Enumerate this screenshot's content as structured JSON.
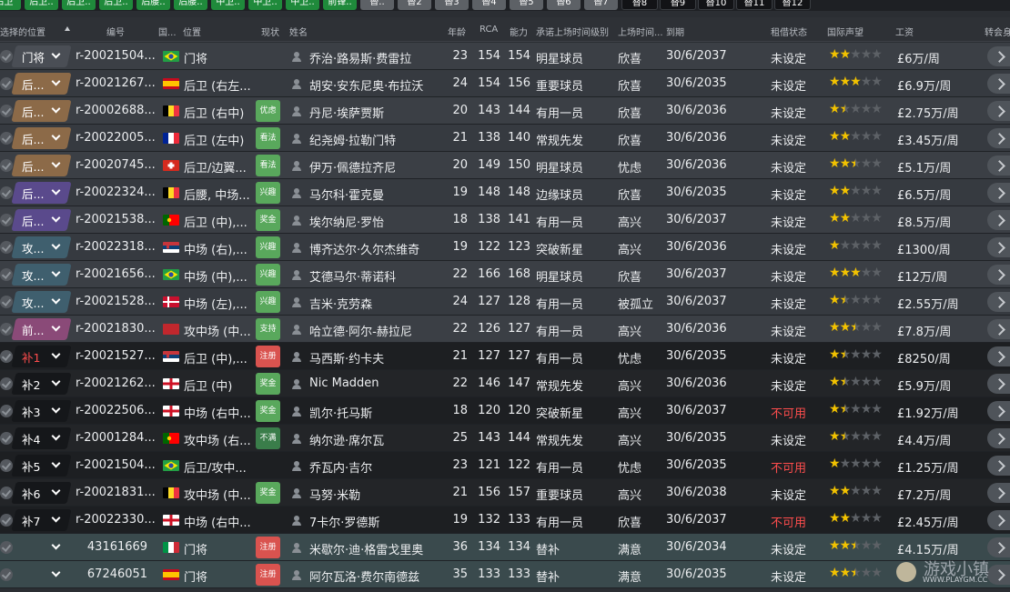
{
  "toolbar": {
    "buttons": [
      {
        "label": "后卫",
        "style": "green"
      },
      {
        "label": "后卫..",
        "style": "green"
      },
      {
        "label": "后卫..",
        "style": "green"
      },
      {
        "label": "后卫..",
        "style": "green"
      },
      {
        "label": "后腰..",
        "style": "green"
      },
      {
        "label": "后腰..",
        "style": "green"
      },
      {
        "label": "中卫..",
        "style": "green"
      },
      {
        "label": "中卫..",
        "style": "green"
      },
      {
        "label": "中卫..",
        "style": "green"
      },
      {
        "label": "前锋..",
        "style": "green"
      },
      {
        "label": "替..",
        "style": "grey"
      },
      {
        "label": "替2",
        "style": "grey"
      },
      {
        "label": "替3",
        "style": "grey"
      },
      {
        "label": "替4",
        "style": "grey"
      },
      {
        "label": "替5",
        "style": "grey"
      },
      {
        "label": "替6",
        "style": "grey"
      },
      {
        "label": "替7",
        "style": "grey"
      },
      {
        "label": "替8",
        "style": "black"
      },
      {
        "label": "替9",
        "style": "black"
      },
      {
        "label": "替10",
        "style": "black"
      },
      {
        "label": "替11",
        "style": "black"
      },
      {
        "label": "替12",
        "style": "black"
      }
    ]
  },
  "columns": {
    "selected_position": "选择的位置",
    "id": "编号",
    "nation": "国...",
    "position": "位置",
    "status": "现状",
    "name": "姓名",
    "age": "年龄",
    "rca": "RCA",
    "ability": "能力",
    "promised_level": "承诺上场时间级别",
    "playing_time": "上场时间...",
    "expires": "到期",
    "loan_status": "租借状态",
    "intl_reputation": "国际声望",
    "wage": "工资",
    "transfer": "转会身"
  },
  "colors": {
    "gk_sel": "#4a4e55",
    "def_brown": "#8c6a48",
    "def_purple": "#5a4a8c",
    "mid_teal": "#3f5f6e",
    "fwd_pink": "#8a4a78",
    "sub_black": "#15171a",
    "star": "#f2c200",
    "star_off": "#5d6166",
    "unavailable": "#ff4d4d"
  },
  "players": [
    {
      "sel": "门将",
      "sel_type": "gk",
      "id": "r-20021504...",
      "flag": "brazil",
      "pos": "门将",
      "badge": "",
      "badge_color": "",
      "name": "乔治·路易斯·费雷拉",
      "age": "23",
      "rca": "154",
      "ab": "154",
      "level": "明星球员",
      "time": "欣喜",
      "exp": "30/6/2037",
      "loan": "未设定",
      "stars": 2,
      "half": false,
      "wage": "£6万/周",
      "row": "main"
    },
    {
      "sel": "后...",
      "sel_type": "def_brown",
      "id": "r-20021267...",
      "flag": "spain",
      "pos": "后卫 (右左...",
      "badge": "",
      "badge_color": "",
      "name": "胡安·安东尼奥·布拉沃",
      "age": "24",
      "rca": "154",
      "ab": "156",
      "level": "重要球员",
      "time": "欣喜",
      "exp": "30/6/2035",
      "loan": "未设定",
      "stars": 3,
      "half": false,
      "wage": "£6.9万/周",
      "row": "main"
    },
    {
      "sel": "后...",
      "sel_type": "def_brown",
      "id": "r-20002688...",
      "flag": "belgium",
      "pos": "后卫 (右中)",
      "badge": "优虑",
      "badge_color": "#59a85c",
      "name": "丹尼·埃萨贾斯",
      "age": "20",
      "rca": "143",
      "ab": "144",
      "level": "有用一员",
      "time": "欣喜",
      "exp": "30/6/2036",
      "loan": "未设定",
      "stars": 1,
      "half": true,
      "wage": "£2.75万/周",
      "row": "main"
    },
    {
      "sel": "后...",
      "sel_type": "def_brown",
      "id": "r-20022005...",
      "flag": "france",
      "pos": "后卫 (左中)",
      "badge": "看法",
      "badge_color": "#59a85c",
      "name": "纪尧姆·拉勒门特",
      "age": "21",
      "rca": "138",
      "ab": "140",
      "level": "常规先发",
      "time": "欣喜",
      "exp": "30/6/2036",
      "loan": "未设定",
      "stars": 2,
      "half": false,
      "wage": "£3.45万/周",
      "row": "main"
    },
    {
      "sel": "后...",
      "sel_type": "def_brown",
      "id": "r-20020745...",
      "flag": "switzerland",
      "pos": "后卫/边翼...",
      "badge": "看法",
      "badge_color": "#59a85c",
      "name": "伊万·佩德拉齐尼",
      "age": "20",
      "rca": "149",
      "ab": "150",
      "level": "明星球员",
      "time": "忧虑",
      "exp": "30/6/2036",
      "loan": "未设定",
      "stars": 2,
      "half": true,
      "wage": "£5.1万/周",
      "row": "main"
    },
    {
      "sel": "后...",
      "sel_type": "def_purple",
      "id": "r-20022324...",
      "flag": "belgium",
      "pos": "后腰, 中场...",
      "badge": "兴趣",
      "badge_color": "#59a85c",
      "name": "马尔科·霍克曼",
      "age": "19",
      "rca": "148",
      "ab": "148",
      "level": "边缘球员",
      "time": "欣喜",
      "exp": "30/6/2035",
      "loan": "未设定",
      "stars": 2,
      "half": false,
      "wage": "£6.5万/周",
      "row": "main"
    },
    {
      "sel": "后...",
      "sel_type": "def_purple",
      "id": "r-20021538...",
      "flag": "portugal",
      "pos": "后卫 (中),...",
      "badge": "奖金",
      "badge_color": "#59a85c",
      "name": "埃尔纳尼·罗怡",
      "age": "18",
      "rca": "138",
      "ab": "141",
      "level": "有用一员",
      "time": "高兴",
      "exp": "30/6/2037",
      "loan": "未设定",
      "stars": 2,
      "half": false,
      "wage": "£8.5万/周",
      "row": "main"
    },
    {
      "sel": "攻...",
      "sel_type": "mid_teal",
      "id": "r-20022318...",
      "flag": "serbia",
      "pos": "中场 (右),...",
      "badge": "兴趣",
      "badge_color": "#59a85c",
      "name": "博齐达尔·久尔杰维奇",
      "age": "19",
      "rca": "122",
      "ab": "123",
      "level": "突破新星",
      "time": "高兴",
      "exp": "30/6/2036",
      "loan": "未设定",
      "stars": 1,
      "half": false,
      "wage": "£1300/周",
      "row": "main"
    },
    {
      "sel": "攻...",
      "sel_type": "mid_teal",
      "id": "r-20021656...",
      "flag": "brazil",
      "pos": "中场 (中),...",
      "badge": "兴趣",
      "badge_color": "#59a85c",
      "name": "艾德马尔·蒂诺科",
      "age": "22",
      "rca": "166",
      "ab": "168",
      "level": "明星球员",
      "time": "欣喜",
      "exp": "30/6/2037",
      "loan": "未设定",
      "stars": 3,
      "half": false,
      "wage": "£12万/周",
      "row": "main"
    },
    {
      "sel": "攻...",
      "sel_type": "mid_teal",
      "id": "r-20021528...",
      "flag": "denmark",
      "pos": "中场 (左),...",
      "badge": "兴趣",
      "badge_color": "#59a85c",
      "name": "吉米·克劳森",
      "age": "24",
      "rca": "127",
      "ab": "128",
      "level": "有用一员",
      "time": "被孤立",
      "exp": "30/6/2037",
      "loan": "未设定",
      "stars": 1,
      "half": true,
      "wage": "£2.55万/周",
      "row": "main"
    },
    {
      "sel": "前...",
      "sel_type": "fwd_pink",
      "id": "r-20021830...",
      "flag": "red",
      "pos": "攻中场 (中...",
      "badge": "支持",
      "badge_color": "#59a85c",
      "name": "哈立德·阿尔-赫拉尼",
      "age": "22",
      "rca": "126",
      "ab": "127",
      "level": "有用一员",
      "time": "高兴",
      "exp": "30/6/2036",
      "loan": "未设定",
      "stars": 2,
      "half": true,
      "wage": "£7.8万/周",
      "row": "main"
    },
    {
      "sel": "补1",
      "sel_type": "sub_red",
      "id": "r-20021527...",
      "flag": "serbia",
      "pos": "后卫 (中),...",
      "badge": "注册",
      "badge_color": "#d9534f",
      "name": "马西斯·约卡夫",
      "age": "21",
      "rca": "127",
      "ab": "127",
      "level": "有用一员",
      "time": "忧虑",
      "exp": "30/6/2035",
      "loan": "未设定",
      "stars": 1,
      "half": true,
      "wage": "£8250/周",
      "row": "sub"
    },
    {
      "sel": "补2",
      "sel_type": "sub",
      "id": "r-20021262...",
      "flag": "england",
      "pos": "后卫 (中)",
      "badge": "奖金",
      "badge_color": "#59a85c",
      "name": "Nic Madden",
      "age": "22",
      "rca": "146",
      "ab": "147",
      "level": "常规先发",
      "time": "高兴",
      "exp": "30/6/2036",
      "loan": "未设定",
      "stars": 1,
      "half": true,
      "wage": "£5.9万/周",
      "row": "sub"
    },
    {
      "sel": "补3",
      "sel_type": "sub",
      "id": "r-20022506...",
      "flag": "england",
      "pos": "中场 (右中...",
      "badge": "奖金",
      "badge_color": "#59a85c",
      "name": "凯尔·托马斯",
      "age": "18",
      "rca": "120",
      "ab": "120",
      "level": "突破新星",
      "time": "高兴",
      "exp": "30/6/2037",
      "loan": "不可用",
      "stars": 1,
      "half": true,
      "wage": "£1.92万/周",
      "row": "sub"
    },
    {
      "sel": "补4",
      "sel_type": "sub",
      "id": "r-20001284...",
      "flag": "portugal",
      "pos": "攻中场 (右...",
      "badge": "不满",
      "badge_color": "#3a7d4a",
      "name": "纳尔逊·席尔瓦",
      "age": "25",
      "rca": "143",
      "ab": "144",
      "level": "常规先发",
      "time": "高兴",
      "exp": "30/6/2035",
      "loan": "未设定",
      "stars": 1,
      "half": true,
      "wage": "£4.4万/周",
      "row": "sub"
    },
    {
      "sel": "补5",
      "sel_type": "sub",
      "id": "r-20021504...",
      "flag": "brazil",
      "pos": "后卫/攻中...",
      "badge": "",
      "badge_color": "",
      "name": "乔瓦内·吉尔",
      "age": "23",
      "rca": "121",
      "ab": "122",
      "level": "有用一员",
      "time": "忧虑",
      "exp": "30/6/2035",
      "loan": "不可用",
      "stars": 1,
      "half": false,
      "wage": "£1.25万/周",
      "row": "sub"
    },
    {
      "sel": "补6",
      "sel_type": "sub",
      "id": "r-20021831...",
      "flag": "belgium",
      "pos": "攻中场 (中...",
      "badge": "奖金",
      "badge_color": "#59a85c",
      "name": "马努·米勒",
      "age": "21",
      "rca": "156",
      "ab": "157",
      "level": "重要球员",
      "time": "高兴",
      "exp": "30/6/2038",
      "loan": "未设定",
      "stars": 2,
      "half": false,
      "wage": "£7.2万/周",
      "row": "sub"
    },
    {
      "sel": "补7",
      "sel_type": "sub",
      "id": "r-20022330...",
      "flag": "england",
      "pos": "中场 (右中...",
      "badge": "",
      "badge_color": "",
      "name": "7卡尔·罗德斯",
      "age": "19",
      "rca": "132",
      "ab": "133",
      "level": "有用一员",
      "time": "欣喜",
      "exp": "30/6/2037",
      "loan": "不可用",
      "stars": 2,
      "half": false,
      "wage": "£2.45万/周",
      "row": "sub"
    },
    {
      "sel": "",
      "sel_type": "none",
      "id": "43161669",
      "flag": "italy",
      "pos": "门将",
      "badge": "注册",
      "badge_color": "#d9534f",
      "name": "米歇尔·迪·格雷戈里奥",
      "age": "36",
      "rca": "134",
      "ab": "134",
      "level": "替补",
      "time": "满意",
      "exp": "30/6/2034",
      "loan": "未设定",
      "stars": 2,
      "half": true,
      "wage": "£4.15万/周",
      "row": "res"
    },
    {
      "sel": "",
      "sel_type": "none",
      "id": "67246051",
      "flag": "spain",
      "pos": "门将",
      "badge": "注册",
      "badge_color": "#d9534f",
      "name": "阿尔瓦洛·费尔南德兹",
      "age": "35",
      "rca": "133",
      "ab": "133",
      "level": "替补",
      "time": "满意",
      "exp": "30/6/2035",
      "loan": "未设定",
      "stars": 2,
      "half": true,
      "wage": "",
      "row": "res"
    }
  ],
  "watermark": {
    "text": "游戏小镇",
    "url": "WWW.PLAYGM.CC"
  }
}
